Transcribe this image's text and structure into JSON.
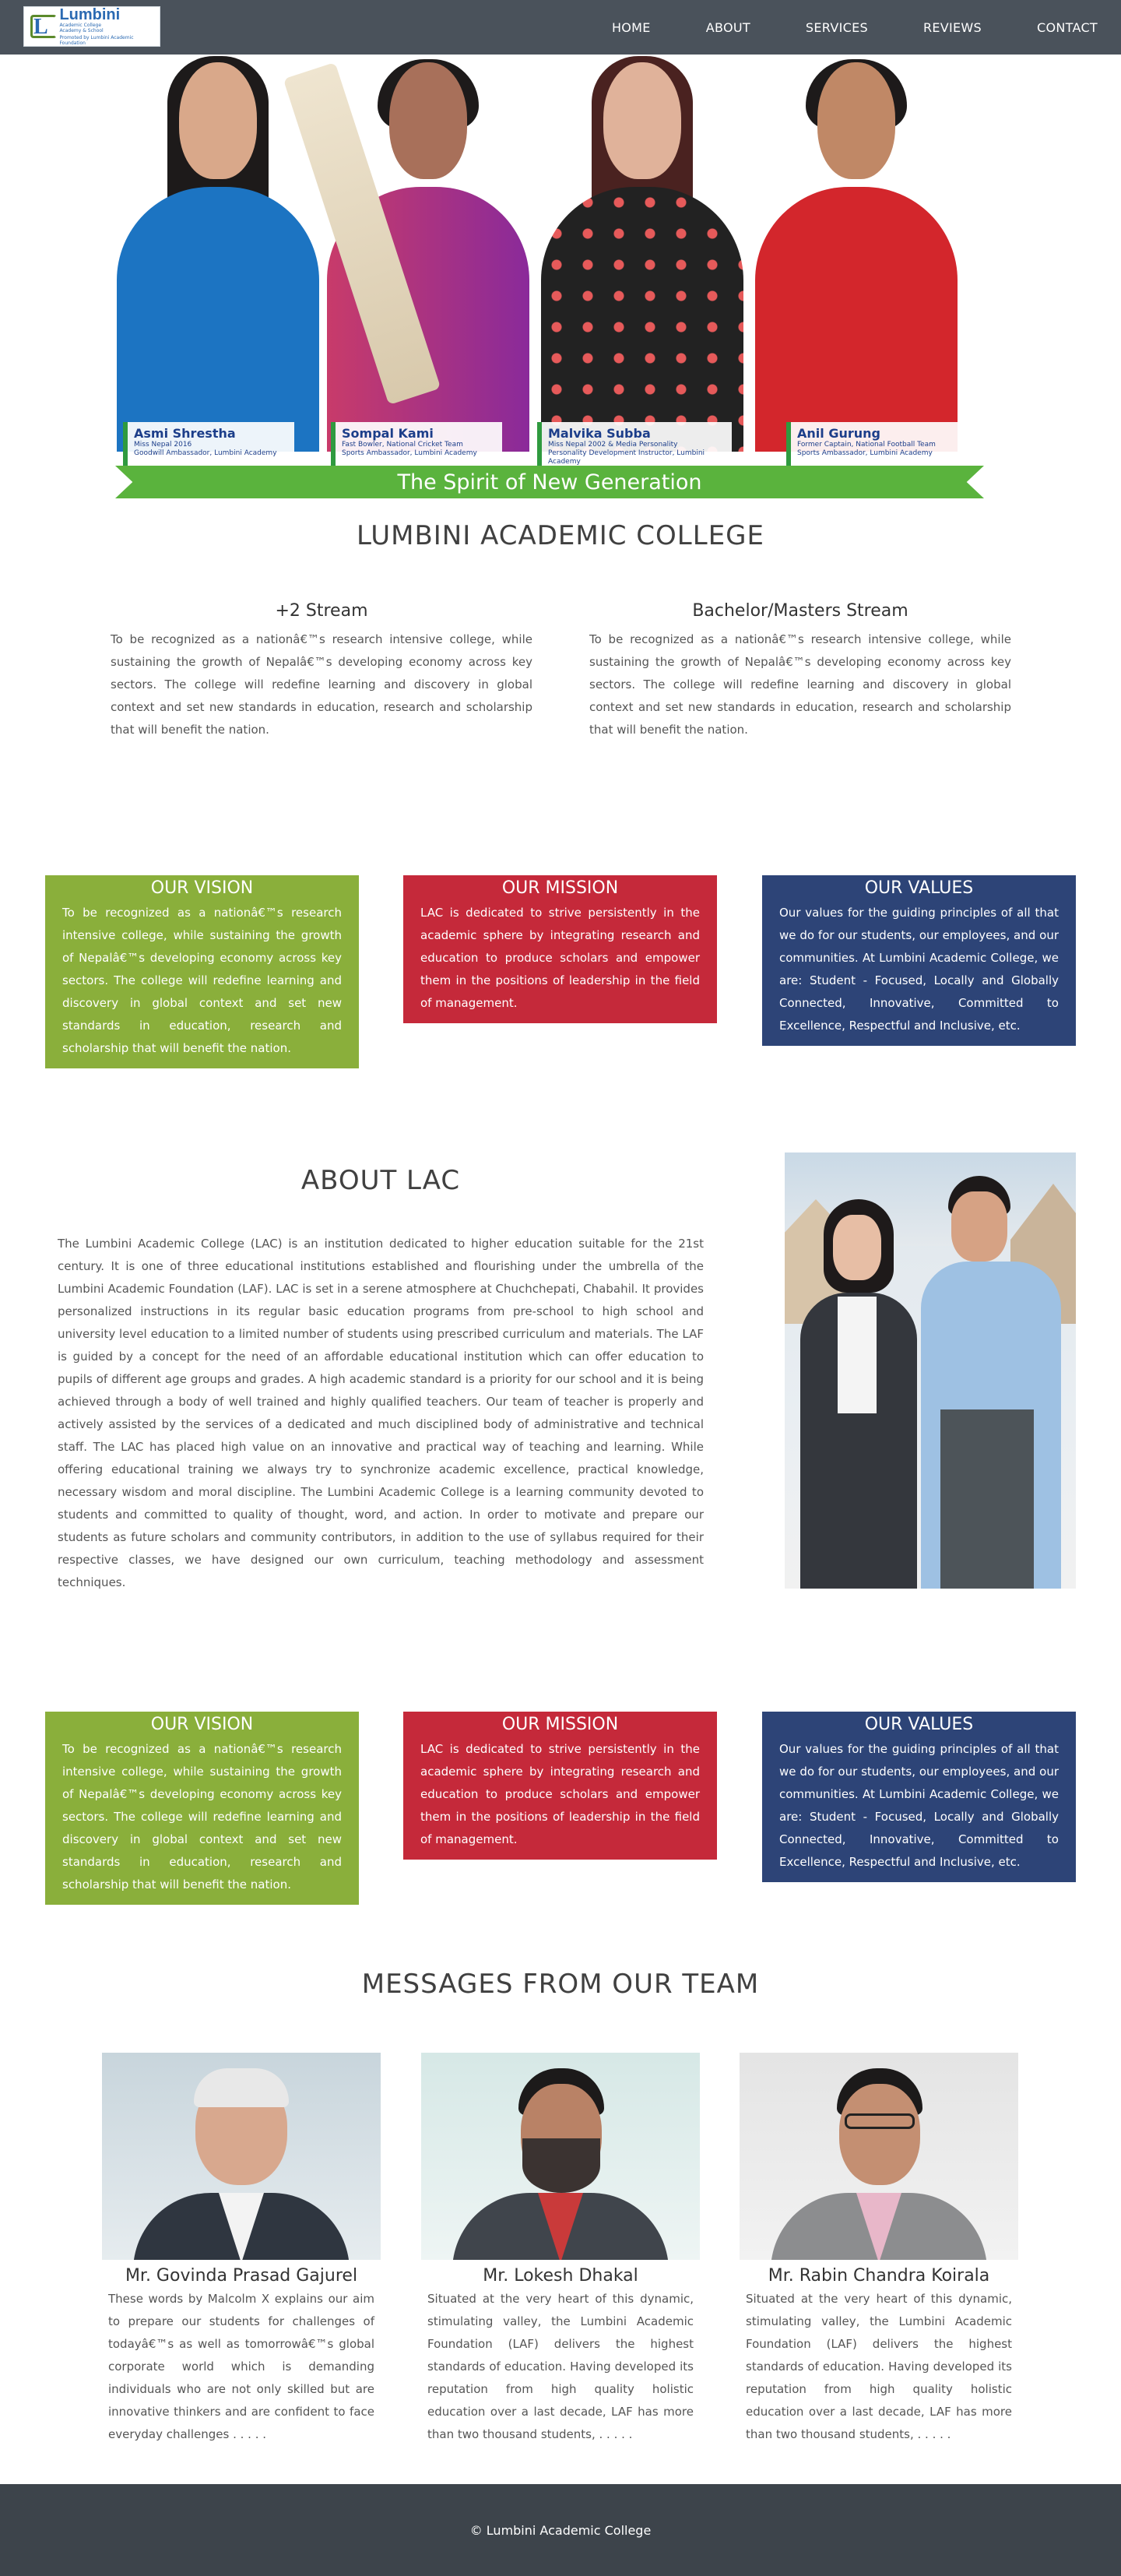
{
  "nav": {
    "logo_name": "Lumbini",
    "logo_subtitle": "Academic College Academy & School",
    "logo_promo": "Promoted by Lumbini Academic Foundation",
    "items": [
      "HOME",
      "ABOUT",
      "SERVICES",
      "REVIEWS",
      "CONTACT"
    ]
  },
  "hero": {
    "people": [
      {
        "name": "Asmi Shrestha",
        "line1": "Miss Nepal 2016",
        "line2": "Goodwill Ambassador, Lumbini Academy"
      },
      {
        "name": "Sompal Kami",
        "line1": "Fast Bowler, National Cricket Team",
        "line2": "Sports Ambassador, Lumbini Academy"
      },
      {
        "name": "Malvika Subba",
        "line1": "Miss Nepal 2002 & Media Personality",
        "line2": "Personality Development Instructor, Lumbini Academy"
      },
      {
        "name": "Anil Gurung",
        "line1": "Former Captain, National Football Team",
        "line2": "Sports Ambassador, Lumbini Academy"
      }
    ],
    "banner": "The Spirit of New Generation"
  },
  "college_title": "LUMBINI ACADEMIC COLLEGE",
  "streams": [
    {
      "title": "+2 Stream",
      "text": "To be recognized as a nationâ€™s research intensive college, while sustaining the growth of Nepalâ€™s developing economy across key sectors. The college will redefine learning and discovery in global context and set new standards in education, research and scholarship that will benefit the nation."
    },
    {
      "title": "Bachelor/Masters Stream",
      "text": "To be recognized as a nationâ€™s research intensive college, while sustaining the growth of Nepalâ€™s developing economy across key sectors. The college will redefine learning and discovery in global context and set new standards in education, research and scholarship that will benefit the nation."
    }
  ],
  "vmv": {
    "vision_title": "OUR VISION",
    "vision_text": "To be recognized as a nationâ€™s research intensive college, while sustaining the growth of Nepalâ€™s developing economy across key sectors. The college will redefine learning and discovery in global context and set new standards in education, research and scholarship that will benefit the nation.",
    "mission_title": "OUR MISSION",
    "mission_text": "LAC is dedicated to strive persistently in the academic sphere by integrating research and education to produce scholars and empower them in the positions of leadership in the field of management.",
    "values_title": "OUR VALUES",
    "values_text": "Our values for the guiding principles of all that we do for our students, our employees, and our communities. At Lumbini Academic College, we are: Student - Focused, Locally and Globally Connected, Innovative, Committed to Excellence, Respectful and Inclusive, etc."
  },
  "about": {
    "title": "ABOUT LAC",
    "text": "The Lumbini Academic College (LAC) is an institution dedicated to higher education suitable for the 21st century. It is one of three educational institutions established and flourishing under the umbrella of the Lumbini Academic Foundation (LAF). LAC is set in a serene atmosphere at Chuchchepati, Chabahil. It provides personalized instructions in its regular basic education programs from pre-school to high school and university level education to a limited number of students using prescribed curriculum and materials. The LAF is guided by a concept for the need of an affordable educational institution which can offer education to pupils of different age groups and grades. A high academic standard is a priority for our school and it is being achieved through a body of well trained and highly qualified teachers. Our team of teacher is properly and actively assisted by the services of a dedicated and much disciplined body of administrative and technical staff. The LAC has placed high value on an innovative and practical way of teaching and learning. While offering educational training we always try to synchronize academic excellence, practical knowledge, necessary wisdom and moral discipline. The Lumbini Academic College is a learning community devoted to students and committed to quality of thought, word, and action. In order to motivate and prepare our students as future scholars and community contributors, in addition to the use of syllabus required for their respective classes, we have designed our own curriculum, teaching methodology and assessment techniques."
  },
  "messages": {
    "title": "MESSAGES FROM OUR TEAM",
    "members": [
      {
        "name": "Mr. Govinda Prasad Gajurel",
        "text": "These words by Malcolm X explains our aim to prepare our students for challenges of todayâ€™s as well as tomorrowâ€™s global corporate world which is demanding individuals who are not only skilled but are innovative thinkers and are confident to face everyday challenges . . . . ."
      },
      {
        "name": "Mr. Lokesh Dhakal",
        "text": "Situated at the very heart of this dynamic, stimulating valley, the Lumbini Academic Foundation (LAF) delivers the highest standards of education. Having developed its reputation from high quality holistic education over a last decade, LAF has more than two thousand students, . . . . ."
      },
      {
        "name": "Mr. Rabin Chandra Koirala",
        "text": "Situated at the very heart of this dynamic, stimulating valley, the Lumbini Academic Foundation (LAF) delivers the highest standards of education. Having developed its reputation from high quality holistic education over a last decade, LAF has more than two thousand students, . . . . ."
      }
    ]
  },
  "footer": {
    "text": "© Lumbini Academic College"
  },
  "colors": {
    "nav": "#4a525b",
    "green": "#8aaf3b",
    "red": "#c5293a",
    "blue": "#2d4477",
    "banner": "#5ab33d",
    "footer": "#3d444b"
  }
}
